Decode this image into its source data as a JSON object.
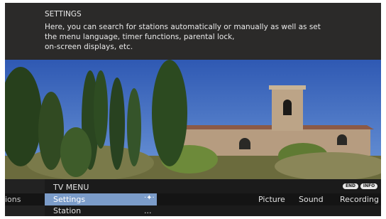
{
  "info": {
    "title": "SETTINGS",
    "lines": [
      "Here, you can search for stations automatically or manually as well as set",
      "the menu language, timer functions, parental lock,",
      "on-screen displays, etc."
    ]
  },
  "menu": {
    "title": "TV MENU",
    "prev_tab_partial": "ions",
    "items": [
      {
        "label": "Settings",
        "selected": true,
        "trail_icon": "navigate-arrows-icon",
        "trail_text": "·✦·"
      },
      {
        "label": "Station",
        "selected": false,
        "trail_text": "..."
      }
    ],
    "tabs": [
      "Picture",
      "Sound",
      "Recording"
    ],
    "buttons": {
      "end": "END",
      "info": "INFO"
    }
  },
  "colors": {
    "header_bg": "#2b2a29",
    "menu_bg": "#1b1b1b",
    "selection": "#7b9cc9"
  }
}
